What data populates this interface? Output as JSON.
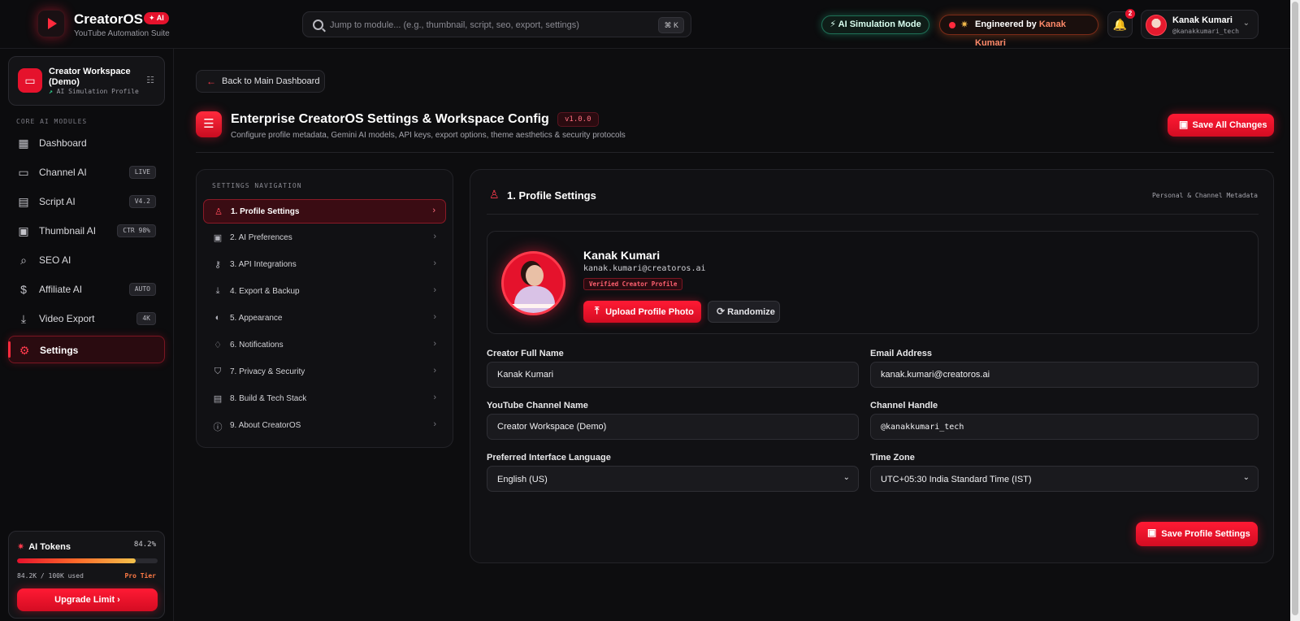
{
  "header": {
    "brand": "CreatorOS",
    "brand_badge": "AI",
    "brand_subtitle": "YouTube Automation Suite",
    "search_placeholder": "Jump to module... (e.g., thumbnail, script, seo, export, settings)",
    "search_shortcut": "⌘ K",
    "sim_mode_label": "AI Simulation Mode",
    "engineered_prefix": "Engineered by",
    "engineered_name": "Kanak Kumari",
    "notification_count": "2",
    "user_name": "Kanak Kumari",
    "user_handle": "@kanakkumari_tech"
  },
  "sidebar": {
    "workspace_title": "Creator Workspace (Demo)",
    "workspace_sub": "AI Simulation Profile",
    "section_label": "CORE AI MODULES",
    "items": [
      {
        "label": "Dashboard",
        "icon": "dashboard-icon",
        "tag": ""
      },
      {
        "label": "Channel AI",
        "icon": "tv-icon",
        "tag": "LIVE"
      },
      {
        "label": "Script AI",
        "icon": "document-icon",
        "tag": "V4.2"
      },
      {
        "label": "Thumbnail AI",
        "icon": "image-icon",
        "tag": "CTR 98%"
      },
      {
        "label": "SEO AI",
        "icon": "search-icon",
        "tag": ""
      },
      {
        "label": "Affiliate AI",
        "icon": "dollar-icon",
        "tag": "AUTO"
      },
      {
        "label": "Video Export",
        "icon": "download-icon",
        "tag": "4K"
      },
      {
        "label": "Settings",
        "icon": "gear-icon",
        "tag": ""
      }
    ],
    "active_item": "Settings",
    "tokens": {
      "title": "AI Tokens",
      "percent_label": "84.2%",
      "percent_value": 84.2,
      "used": "84.2K / 100K used",
      "tier": "Pro Tier",
      "upgrade_label": "Upgrade Limit"
    }
  },
  "main": {
    "back_label": "Back to Main Dashboard",
    "title": "Enterprise CreatorOS Settings & Workspace Config",
    "version": "v1.0.0",
    "subtitle": "Configure profile metadata, Gemini AI models, API keys, export options, theme aesthetics & security protocols",
    "save_all_label": "Save All Changes",
    "settings_nav": {
      "label": "SETTINGS NAVIGATION",
      "items": [
        {
          "label": "1. Profile Settings",
          "icon": "user-icon"
        },
        {
          "label": "2. AI Preferences",
          "icon": "chip-icon"
        },
        {
          "label": "3. API Integrations",
          "icon": "key-icon"
        },
        {
          "label": "4. Export & Backup",
          "icon": "download-icon"
        },
        {
          "label": "5. Appearance",
          "icon": "palette-icon"
        },
        {
          "label": "6. Notifications",
          "icon": "bell-icon"
        },
        {
          "label": "7. Privacy & Security",
          "icon": "shield-icon"
        },
        {
          "label": "8. Build & Tech Stack",
          "icon": "code-file-icon"
        },
        {
          "label": "9. About CreatorOS",
          "icon": "info-icon"
        }
      ]
    },
    "panel": {
      "title": "1. Profile Settings",
      "meta": "Personal & Channel Metadata",
      "profile": {
        "name": "Kanak Kumari",
        "email": "kanak.kumari@creatoros.ai",
        "badge": "Verified Creator Profile",
        "upload_label": "Upload Profile Photo",
        "randomize_label": "Randomize"
      },
      "fields": {
        "full_name_label": "Creator Full Name",
        "full_name_value": "Kanak Kumari",
        "email_label": "Email Address",
        "email_value": "kanak.kumari@creatoros.ai",
        "channel_label": "YouTube Channel Name",
        "channel_value": "Creator Workspace (Demo)",
        "handle_label": "Channel Handle",
        "handle_value": "@kanakkumari_tech",
        "language_label": "Preferred Interface Language",
        "language_value": "English (US)",
        "timezone_label": "Time Zone",
        "timezone_value": "UTC+05:30 India Standard Time (IST)"
      },
      "save_label": "Save Profile Settings"
    }
  }
}
